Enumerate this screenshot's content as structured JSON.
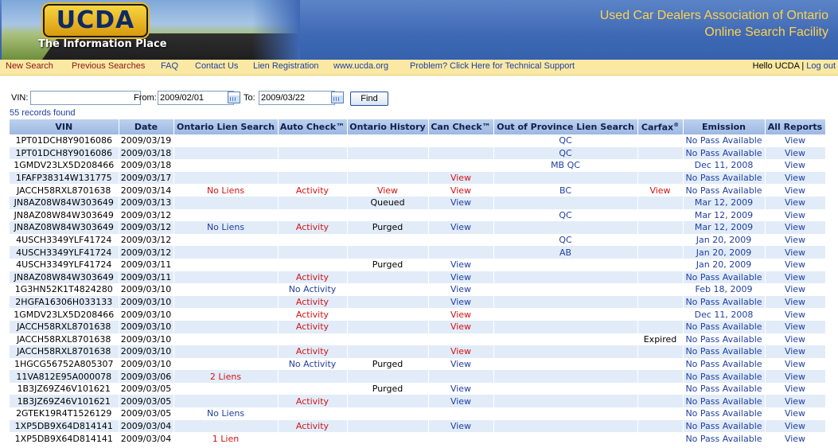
{
  "header": {
    "logo_text": "UCDA",
    "tagline": "The Information Place",
    "title_line1": "Used Car Dealers Association of Ontario",
    "title_line2": "Online Search Facility"
  },
  "nav": {
    "items": [
      "New Search",
      "Previous Searches",
      "FAQ",
      "Contact Us",
      "Lien Registration",
      "www.ucda.org",
      "Problem? Click Here for Technical Support"
    ],
    "greeting": "Hello UCDA",
    "separator": "|",
    "logout": "Log out"
  },
  "search": {
    "vin_label": "VIN:",
    "vin_value": "",
    "from_label": "From:",
    "from_value": "2009/02/01",
    "to_label": "To:",
    "to_value": "2009/03/22",
    "find_label": "Find"
  },
  "records_found": "55 records found",
  "colors": {
    "red": "#d21414",
    "blue": "#1f3fa0",
    "nav_bg": "#fbe9a3",
    "header_title": "#ffd34c",
    "row_alt": "#e2ecf9"
  },
  "table": {
    "headers": [
      "VIN",
      "Date",
      "Ontario Lien Search",
      "Auto Check™",
      "Ontario History",
      "Can Check™",
      "Out of Province Lien Search",
      "Carfax",
      "Emission",
      "All Reports"
    ],
    "carfax_mark": "®",
    "rows": [
      {
        "vin": "1PT01DCH8Y9016086",
        "date": "2009/03/19",
        "lien": "",
        "lien_c": "",
        "auto": "",
        "auto_c": "",
        "hist": "",
        "hist_c": "",
        "can": "",
        "can_c": "",
        "oop": "QC",
        "carfax": "",
        "carfax_c": "",
        "emission": "No Pass Available",
        "all": "View"
      },
      {
        "vin": "1PT01DCH8Y9016086",
        "date": "2009/03/18",
        "lien": "",
        "lien_c": "",
        "auto": "",
        "auto_c": "",
        "hist": "",
        "hist_c": "",
        "can": "",
        "can_c": "",
        "oop": "QC",
        "carfax": "",
        "carfax_c": "",
        "emission": "No Pass Available",
        "all": "View"
      },
      {
        "vin": "1GMDV23LX5D208466",
        "date": "2009/03/18",
        "lien": "",
        "lien_c": "",
        "auto": "",
        "auto_c": "",
        "hist": "",
        "hist_c": "",
        "can": "",
        "can_c": "",
        "oop": "MB QC",
        "carfax": "",
        "carfax_c": "",
        "emission": "Dec 11, 2008",
        "all": "View"
      },
      {
        "vin": "1FAFP38314W131775",
        "date": "2009/03/17",
        "lien": "",
        "lien_c": "",
        "auto": "",
        "auto_c": "",
        "hist": "",
        "hist_c": "",
        "can": "View",
        "can_c": "red",
        "oop": "",
        "carfax": "",
        "carfax_c": "",
        "emission": "No Pass Available",
        "all": "View"
      },
      {
        "vin": "JACCH58RXL8701638",
        "date": "2009/03/14",
        "lien": "No Liens",
        "lien_c": "red",
        "auto": "Activity",
        "auto_c": "red",
        "hist": "View",
        "hist_c": "red",
        "can": "View",
        "can_c": "red",
        "oop": "BC",
        "carfax": "View",
        "carfax_c": "red",
        "emission": "No Pass Available",
        "all": "View"
      },
      {
        "vin": "JN8AZ08W84W303649",
        "date": "2009/03/13",
        "lien": "",
        "lien_c": "",
        "auto": "",
        "auto_c": "",
        "hist": "Queued",
        "hist_c": "blk",
        "can": "View",
        "can_c": "blue",
        "oop": "",
        "carfax": "",
        "carfax_c": "",
        "emission": "Mar 12, 2009",
        "all": "View"
      },
      {
        "vin": "JN8AZ08W84W303649",
        "date": "2009/03/12",
        "lien": "",
        "lien_c": "",
        "auto": "",
        "auto_c": "",
        "hist": "",
        "hist_c": "",
        "can": "",
        "can_c": "",
        "oop": "QC",
        "carfax": "",
        "carfax_c": "",
        "emission": "Mar 12, 2009",
        "all": "View"
      },
      {
        "vin": "JN8AZ08W84W303649",
        "date": "2009/03/12",
        "lien": "No Liens",
        "lien_c": "blue",
        "auto": "Activity",
        "auto_c": "red",
        "hist": "Purged",
        "hist_c": "blk",
        "can": "View",
        "can_c": "blue",
        "oop": "",
        "carfax": "",
        "carfax_c": "",
        "emission": "Mar 12, 2009",
        "all": "View"
      },
      {
        "vin": "4USCH3349YLF41724",
        "date": "2009/03/12",
        "lien": "",
        "lien_c": "",
        "auto": "",
        "auto_c": "",
        "hist": "",
        "hist_c": "",
        "can": "",
        "can_c": "",
        "oop": "QC",
        "carfax": "",
        "carfax_c": "",
        "emission": "Jan 20, 2009",
        "all": "View"
      },
      {
        "vin": "4USCH3349YLF41724",
        "date": "2009/03/12",
        "lien": "",
        "lien_c": "",
        "auto": "",
        "auto_c": "",
        "hist": "",
        "hist_c": "",
        "can": "",
        "can_c": "",
        "oop": "AB",
        "carfax": "",
        "carfax_c": "",
        "emission": "Jan 20, 2009",
        "all": "View"
      },
      {
        "vin": "4USCH3349YLF41724",
        "date": "2009/03/11",
        "lien": "",
        "lien_c": "",
        "auto": "",
        "auto_c": "",
        "hist": "Purged",
        "hist_c": "blk",
        "can": "View",
        "can_c": "blue",
        "oop": "",
        "carfax": "",
        "carfax_c": "",
        "emission": "Jan 20, 2009",
        "all": "View"
      },
      {
        "vin": "JN8AZ08W84W303649",
        "date": "2009/03/11",
        "lien": "",
        "lien_c": "",
        "auto": "Activity",
        "auto_c": "red",
        "hist": "",
        "hist_c": "",
        "can": "View",
        "can_c": "blue",
        "oop": "",
        "carfax": "",
        "carfax_c": "",
        "emission": "No Pass Available",
        "all": "View"
      },
      {
        "vin": "1G3HN52K1T4824280",
        "date": "2009/03/10",
        "lien": "",
        "lien_c": "",
        "auto": "No Activity",
        "auto_c": "blue",
        "hist": "",
        "hist_c": "",
        "can": "View",
        "can_c": "blue",
        "oop": "",
        "carfax": "",
        "carfax_c": "",
        "emission": "Feb 18, 2009",
        "all": "View"
      },
      {
        "vin": "2HGFA16306H033133",
        "date": "2009/03/10",
        "lien": "",
        "lien_c": "",
        "auto": "Activity",
        "auto_c": "red",
        "hist": "",
        "hist_c": "",
        "can": "View",
        "can_c": "blue",
        "oop": "",
        "carfax": "",
        "carfax_c": "",
        "emission": "No Pass Available",
        "all": "View"
      },
      {
        "vin": "1GMDV23LX5D208466",
        "date": "2009/03/10",
        "lien": "",
        "lien_c": "",
        "auto": "Activity",
        "auto_c": "red",
        "hist": "",
        "hist_c": "",
        "can": "View",
        "can_c": "red",
        "oop": "",
        "carfax": "",
        "carfax_c": "",
        "emission": "Dec 11, 2008",
        "all": "View"
      },
      {
        "vin": "JACCH58RXL8701638",
        "date": "2009/03/10",
        "lien": "",
        "lien_c": "",
        "auto": "Activity",
        "auto_c": "red",
        "hist": "",
        "hist_c": "",
        "can": "View",
        "can_c": "red",
        "oop": "",
        "carfax": "",
        "carfax_c": "",
        "emission": "No Pass Available",
        "all": "View"
      },
      {
        "vin": "JACCH58RXL8701638",
        "date": "2009/03/10",
        "lien": "",
        "lien_c": "",
        "auto": "",
        "auto_c": "",
        "hist": "",
        "hist_c": "",
        "can": "",
        "can_c": "",
        "oop": "",
        "carfax": "Expired",
        "carfax_c": "blk",
        "emission": "No Pass Available",
        "all": "View"
      },
      {
        "vin": "JACCH58RXL8701638",
        "date": "2009/03/10",
        "lien": "",
        "lien_c": "",
        "auto": "Activity",
        "auto_c": "red",
        "hist": "",
        "hist_c": "",
        "can": "View",
        "can_c": "red",
        "oop": "",
        "carfax": "",
        "carfax_c": "",
        "emission": "No Pass Available",
        "all": "View"
      },
      {
        "vin": "1HGCG56752A805307",
        "date": "2009/03/10",
        "lien": "",
        "lien_c": "",
        "auto": "No Activity",
        "auto_c": "blue",
        "hist": "Purged",
        "hist_c": "blk",
        "can": "View",
        "can_c": "blue",
        "oop": "",
        "carfax": "",
        "carfax_c": "",
        "emission": "No Pass Available",
        "all": "View"
      },
      {
        "vin": "11VA812E95A000078",
        "date": "2009/03/06",
        "lien": "2 Liens",
        "lien_c": "red",
        "auto": "",
        "auto_c": "",
        "hist": "",
        "hist_c": "",
        "can": "",
        "can_c": "",
        "oop": "",
        "carfax": "",
        "carfax_c": "",
        "emission": "No Pass Available",
        "all": "View"
      },
      {
        "vin": "1B3JZ69Z46V101621",
        "date": "2009/03/05",
        "lien": "",
        "lien_c": "",
        "auto": "",
        "auto_c": "",
        "hist": "Purged",
        "hist_c": "blk",
        "can": "View",
        "can_c": "blue",
        "oop": "",
        "carfax": "",
        "carfax_c": "",
        "emission": "No Pass Available",
        "all": "View"
      },
      {
        "vin": "1B3JZ69Z46V101621",
        "date": "2009/03/05",
        "lien": "",
        "lien_c": "",
        "auto": "Activity",
        "auto_c": "red",
        "hist": "",
        "hist_c": "",
        "can": "View",
        "can_c": "blue",
        "oop": "",
        "carfax": "",
        "carfax_c": "",
        "emission": "No Pass Available",
        "all": "View"
      },
      {
        "vin": "2GTEK19R4T1526129",
        "date": "2009/03/05",
        "lien": "No Liens",
        "lien_c": "blue",
        "auto": "",
        "auto_c": "",
        "hist": "",
        "hist_c": "",
        "can": "",
        "can_c": "",
        "oop": "",
        "carfax": "",
        "carfax_c": "",
        "emission": "No Pass Available",
        "all": "View"
      },
      {
        "vin": "1XP5DB9X64D814141",
        "date": "2009/03/04",
        "lien": "",
        "lien_c": "",
        "auto": "Activity",
        "auto_c": "red",
        "hist": "",
        "hist_c": "",
        "can": "View",
        "can_c": "blue",
        "oop": "",
        "carfax": "",
        "carfax_c": "",
        "emission": "No Pass Available",
        "all": "View"
      },
      {
        "vin": "1XP5DB9X64D814141",
        "date": "2009/03/04",
        "lien": "1 Lien",
        "lien_c": "red",
        "auto": "",
        "auto_c": "",
        "hist": "",
        "hist_c": "",
        "can": "",
        "can_c": "",
        "oop": "",
        "carfax": "",
        "carfax_c": "",
        "emission": "No Pass Available",
        "all": "View"
      }
    ]
  }
}
